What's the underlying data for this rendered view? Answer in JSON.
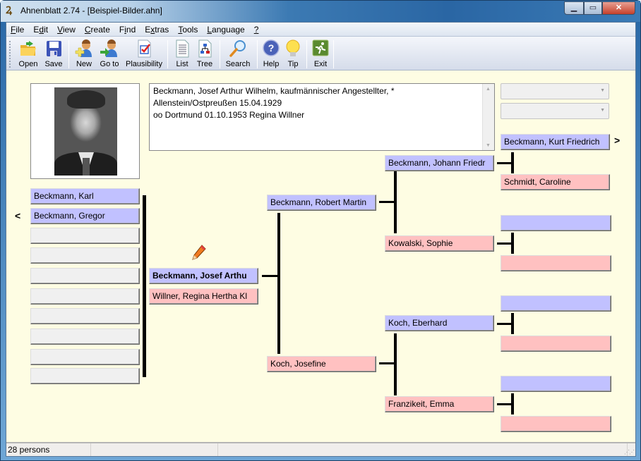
{
  "window": {
    "title": "Ahnenblatt 2.74 - [Beispiel-Bilder.ahn]",
    "app_icon": "ahnenblatt-logo",
    "controls": [
      "minimize",
      "maximize",
      "close"
    ]
  },
  "menu": [
    {
      "label": "File",
      "accel": "F",
      "rest": "ile"
    },
    {
      "label": "Edit",
      "pre": "E",
      "accel": "d",
      "rest": "it"
    },
    {
      "label": "View",
      "accel": "V",
      "rest": "iew"
    },
    {
      "label": "Create",
      "accel": "C",
      "rest": "reate"
    },
    {
      "label": "Find",
      "pre": "F",
      "accel": "i",
      "rest": "nd"
    },
    {
      "label": "Extras",
      "pre": "E",
      "accel": "x",
      "rest": "tras"
    },
    {
      "label": "Tools",
      "accel": "T",
      "rest": "ools"
    },
    {
      "label": "Language",
      "accel": "L",
      "rest": "anguage"
    },
    {
      "label": "?",
      "accel": "?",
      "rest": ""
    }
  ],
  "toolbar": {
    "open": "Open",
    "save": "Save",
    "new": "New",
    "goto": "Go to",
    "plausibility": "Plausibility",
    "list": "List",
    "tree": "Tree",
    "search": "Search",
    "help": "Help",
    "tip": "Tip",
    "exit": "Exit"
  },
  "notes": {
    "text": "Beckmann, Josef Arthur Wilhelm, kaufmännischer Angestellter, *\nAllenstein/Ostpreußen 15.04.1929\noo Dortmund 01.10.1953 Regina Willner"
  },
  "combos": [
    {
      "value": ""
    },
    {
      "value": ""
    }
  ],
  "children": [
    "Beckmann, Karl",
    "Beckmann, Gregor",
    "",
    "",
    "",
    "",
    "",
    "",
    "",
    ""
  ],
  "proband": {
    "name": "Beckmann, Josef Arthu",
    "spouse": "Willner, Regina Hertha Kl"
  },
  "parents": {
    "father": "Beckmann, Robert Martin",
    "mother": "Koch, Josefine"
  },
  "grandparents": {
    "pf": "Beckmann, Johann Friedr",
    "pm": "Kowalski, Sophie",
    "mf": "Koch, Eberhard",
    "mm": "Franzikeit, Emma"
  },
  "great_grandparents": {
    "g1": "Beckmann, Kurt Friedrich",
    "g2": "Schmidt, Caroline",
    "g3": "",
    "g4": "",
    "g5": "",
    "g6": "",
    "g7": "",
    "g8": ""
  },
  "nav": {
    "back": "<",
    "forward": ">"
  },
  "status": {
    "count": "28 persons",
    "cell2": "",
    "cell3": ""
  },
  "colors": {
    "male": "#c1c1ff",
    "female": "#ffc1c1",
    "empty": "#f0f0f0",
    "background": "#fefde3"
  }
}
